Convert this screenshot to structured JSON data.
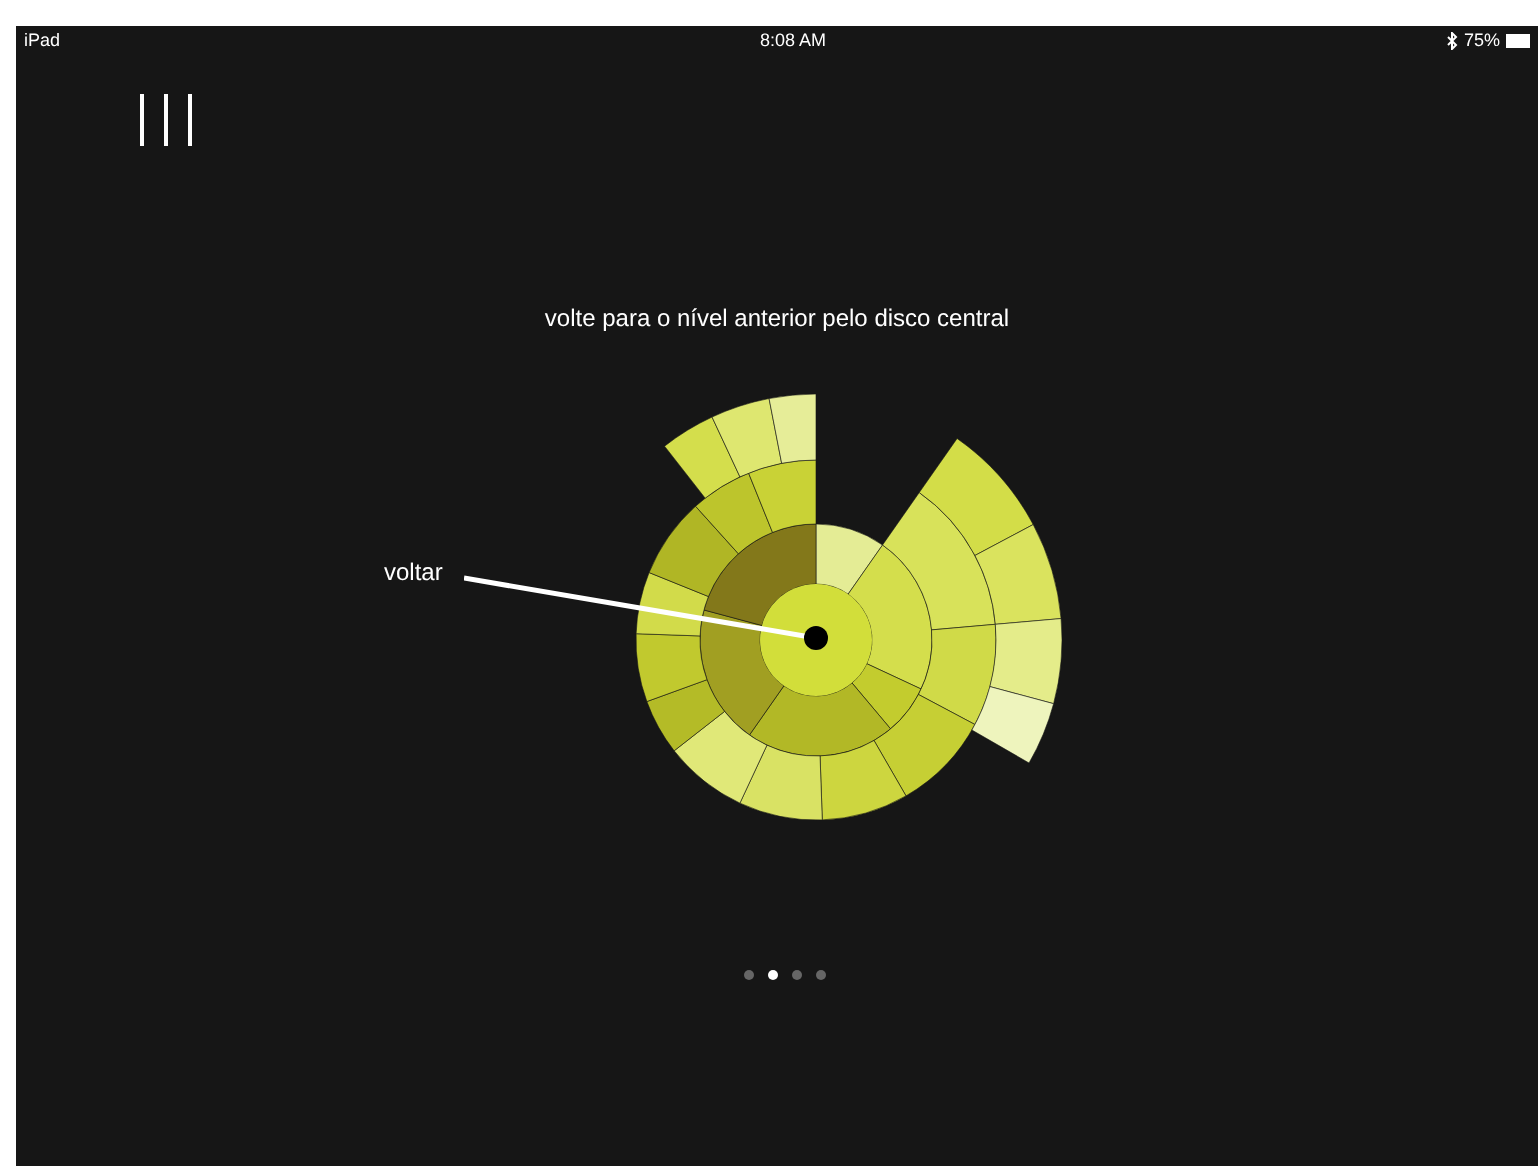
{
  "status_bar": {
    "device": "iPad",
    "time": "8:08 AM",
    "battery": "75%",
    "bluetooth": true
  },
  "menu": {
    "kind": "menu"
  },
  "instruction": "volte para o nível anterior pelo disco central",
  "callout": {
    "label": "voltar"
  },
  "pager": [
    {
      "selected": false
    },
    {
      "selected": true
    },
    {
      "selected": false
    },
    {
      "selected": false
    }
  ]
}
